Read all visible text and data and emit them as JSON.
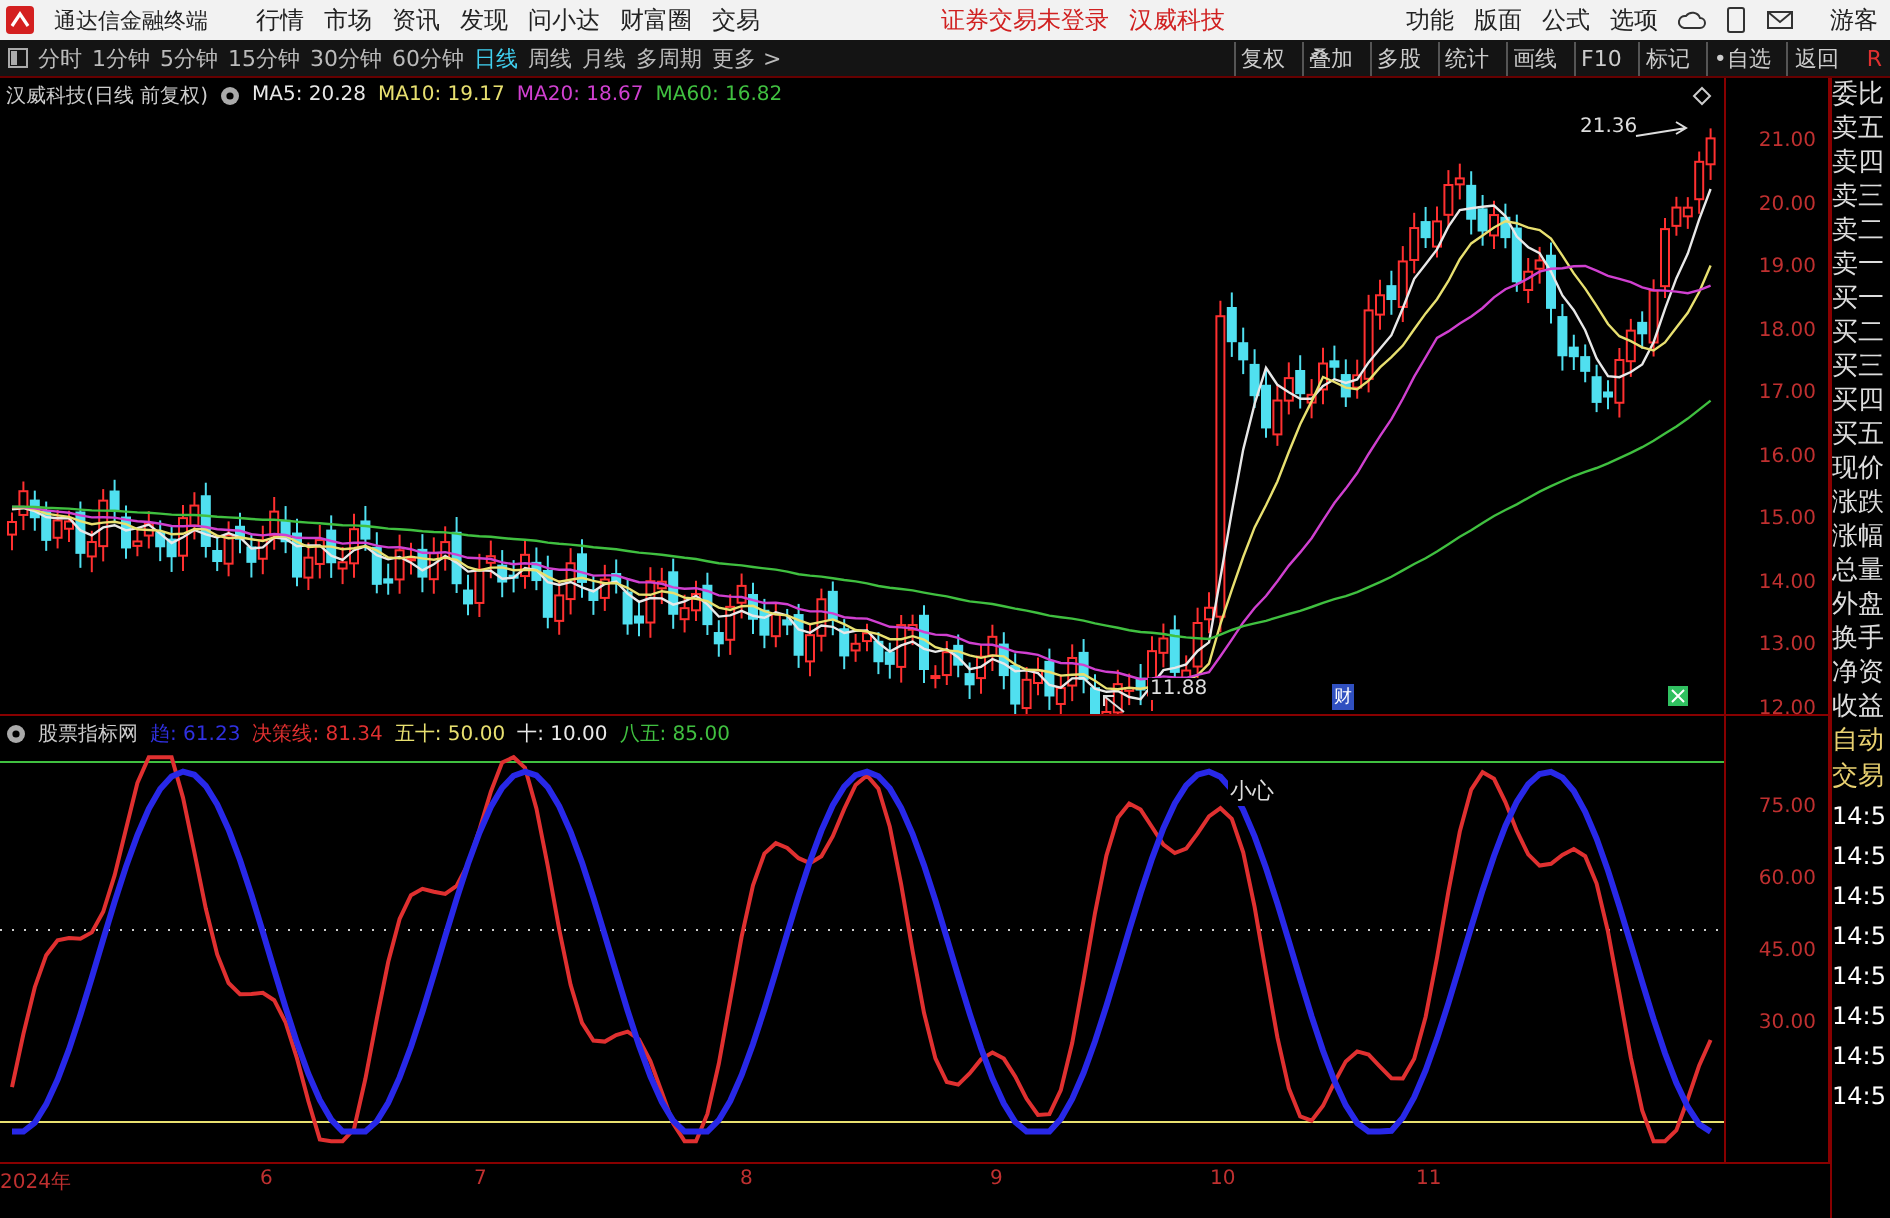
{
  "app_bar": {
    "title": "通达信金融终端",
    "menu": [
      "行情",
      "市场",
      "资讯",
      "发现",
      "问小达",
      "财富圈",
      "交易"
    ],
    "notices": [
      "证券交易未登录",
      "汉威科技"
    ],
    "tools": [
      "功能",
      "版面",
      "公式",
      "选项"
    ],
    "user": "游客"
  },
  "toolbar": {
    "periods": [
      {
        "label": "分时",
        "selected": false
      },
      {
        "label": "1分钟",
        "selected": false
      },
      {
        "label": "5分钟",
        "selected": false
      },
      {
        "label": "15分钟",
        "selected": false
      },
      {
        "label": "30分钟",
        "selected": false
      },
      {
        "label": "60分钟",
        "selected": false
      },
      {
        "label": "日线",
        "selected": true
      },
      {
        "label": "周线",
        "selected": false
      },
      {
        "label": "月线",
        "selected": false
      },
      {
        "label": "多周期",
        "selected": false
      },
      {
        "label": "更多 >",
        "selected": false
      }
    ],
    "actions": [
      "复权",
      "叠加",
      "多股",
      "统计",
      "画线",
      "F10",
      "标记",
      "•自选",
      "返回"
    ],
    "corner": "R"
  },
  "main_chart": {
    "title": "汉威科技(日线 前复权)",
    "legend": [
      {
        "label": "MA5: 20.28",
        "color": "#e8e8e8"
      },
      {
        "label": "MA10: 19.17",
        "color": "#e8e070"
      },
      {
        "label": "MA20: 18.67",
        "color": "#d040d0"
      },
      {
        "label": "MA60: 16.82",
        "color": "#40c040"
      }
    ],
    "price_axis": [
      "21.00",
      "20.00",
      "19.00",
      "18.00",
      "17.00",
      "16.00",
      "15.00",
      "14.00",
      "13.00",
      "12.00"
    ],
    "high_label": "21.36",
    "low_label": "11.88",
    "badge": "财"
  },
  "indicator": {
    "title": "股票指标网",
    "legend": [
      {
        "label": "趋: 61.23",
        "color": "#3030e0"
      },
      {
        "label": "决策线: 81.34",
        "color": "#e03030"
      },
      {
        "label": "五十: 50.00",
        "color": "#e8e070"
      },
      {
        "label": "十: 10.00",
        "color": "#e8e8e8"
      },
      {
        "label": "八五: 85.00",
        "color": "#40c040"
      }
    ],
    "axis": [
      "75.00",
      "60.00",
      "45.00",
      "30.00"
    ],
    "note": "小心"
  },
  "date_axis": [
    "2024年",
    "6",
    "7",
    "8",
    "9",
    "10",
    "11"
  ],
  "side_panel": {
    "labels": [
      "委比",
      "卖五",
      "卖四",
      "卖三",
      "卖二",
      "卖一",
      "买一",
      "买二",
      "买三",
      "买四",
      "买五",
      "现价",
      "涨跌",
      "涨幅",
      "总量",
      "外盘",
      "换手",
      "净资",
      "收益"
    ],
    "trade": [
      "自动",
      "交易"
    ],
    "times": [
      "14:5",
      "14:5",
      "14:5",
      "14:5",
      "14:5",
      "14:5",
      "14:5",
      "14:5"
    ]
  }
}
